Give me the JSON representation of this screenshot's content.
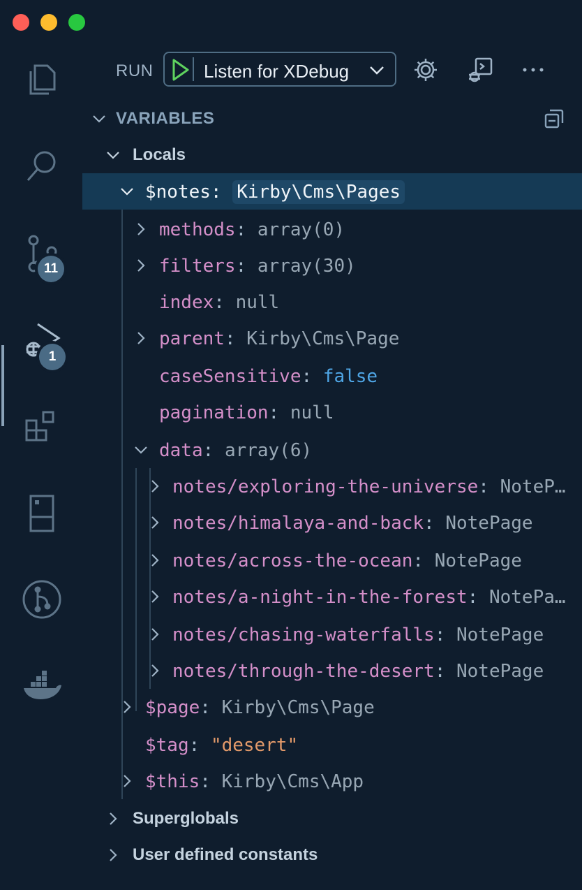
{
  "activity_bar": {
    "icons": [
      "files-icon",
      "search-icon",
      "source-control-icon",
      "run-debug-icon",
      "extensions-icon",
      "remote-explorer-icon",
      "git-graph-icon",
      "docker-icon"
    ],
    "badges": {
      "source_control": "11",
      "run_debug": "1"
    }
  },
  "run": {
    "label": "RUN",
    "config": "Listen for XDebug"
  },
  "variables": {
    "title": "VARIABLES",
    "locals_label": "Locals",
    "notes": {
      "name": "$notes",
      "sep": ": ",
      "value": "Kirby\\Cms\\Pages"
    },
    "children": [
      {
        "name": "methods",
        "sep": ": ",
        "value": "array(0)"
      },
      {
        "name": "filters",
        "sep": ": ",
        "value": "array(30)"
      },
      {
        "name": "index",
        "sep": ": ",
        "value": "null"
      },
      {
        "name": "parent",
        "sep": ": ",
        "value": "Kirby\\Cms\\Page"
      },
      {
        "name": "caseSensitive",
        "sep": ": ",
        "value": "false"
      },
      {
        "name": "pagination",
        "sep": ": ",
        "value": "null"
      },
      {
        "name": "data",
        "sep": ": ",
        "value": "array(6)"
      }
    ],
    "data_items": [
      {
        "name": "notes/exploring-the-universe",
        "sep": ": ",
        "value": "NoteP…"
      },
      {
        "name": "notes/himalaya-and-back",
        "sep": ": ",
        "value": "NotePage"
      },
      {
        "name": "notes/across-the-ocean",
        "sep": ": ",
        "value": "NotePage"
      },
      {
        "name": "notes/a-night-in-the-forest",
        "sep": ": ",
        "value": "NotePa…"
      },
      {
        "name": "notes/chasing-waterfalls",
        "sep": ": ",
        "value": "NotePage"
      },
      {
        "name": "notes/through-the-desert",
        "sep": ": ",
        "value": "NotePage"
      }
    ],
    "others": [
      {
        "name": "$page",
        "sep": ": ",
        "value": "Kirby\\Cms\\Page"
      },
      {
        "name": "$tag",
        "sep": ": ",
        "value": "\"desert\""
      },
      {
        "name": "$this",
        "sep": ": ",
        "value": "Kirby\\Cms\\App"
      }
    ],
    "superglobals_label": "Superglobals",
    "constants_label": "User defined constants"
  },
  "colors": {
    "background": "#0f1d2d",
    "selection": "#153a55",
    "key": "#d48fc9",
    "string": "#e39a6a",
    "boolean": "#4fa6e6",
    "play": "#5fd35f"
  }
}
